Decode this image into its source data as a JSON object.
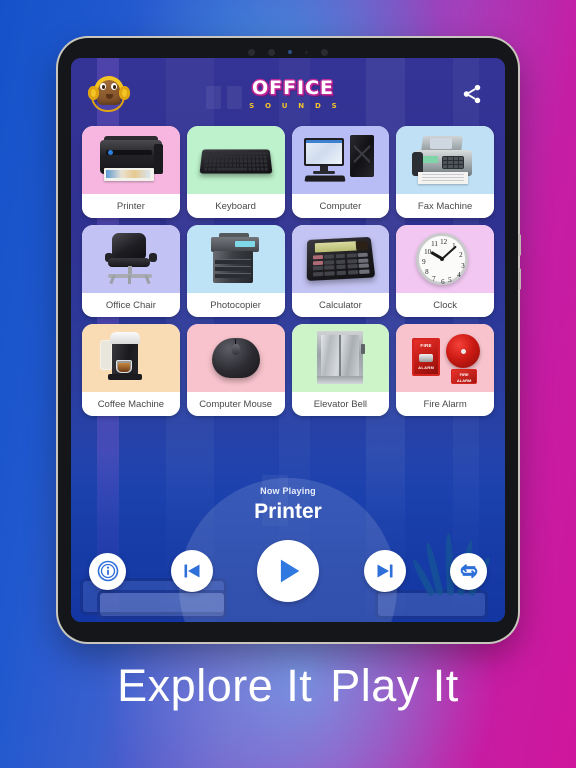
{
  "app": {
    "title_main": "OFFICE",
    "title_sub": "S O U N D S",
    "mascot_icon": "headphone-box-mascot-icon",
    "share_icon": "share-icon"
  },
  "grid": {
    "items": [
      {
        "label": "Printer",
        "art": "printer",
        "bg": "#f6b6e0"
      },
      {
        "label": "Keyboard",
        "art": "keyboard",
        "bg": "#bdf2cc"
      },
      {
        "label": "Computer",
        "art": "computer",
        "bg": "#b9bdf5"
      },
      {
        "label": "Fax Machine",
        "art": "fax",
        "bg": "#bfe0f5"
      },
      {
        "label": "Office Chair",
        "art": "chair",
        "bg": "#c3c2f4"
      },
      {
        "label": "Photocopier",
        "art": "photocopier",
        "bg": "#bfe3f6"
      },
      {
        "label": "Calculator",
        "art": "calculator",
        "bg": "#c3c4f3"
      },
      {
        "label": "Clock",
        "art": "clock",
        "bg": "#f2c8f2"
      },
      {
        "label": "Coffee Machine",
        "art": "coffee",
        "bg": "#fadcb4"
      },
      {
        "label": "Computer Mouse",
        "art": "mouse",
        "bg": "#f8c3cc"
      },
      {
        "label": "Elevator Bell",
        "art": "elevator",
        "bg": "#cdf3c8"
      },
      {
        "label": "Fire Alarm",
        "art": "firealarm",
        "bg": "#f8c3cc"
      }
    ]
  },
  "player": {
    "now_playing_label": "Now Playing",
    "track_title": "Printer",
    "controls": [
      {
        "name": "info-button",
        "icon": "info-icon"
      },
      {
        "name": "previous-button",
        "icon": "skip-previous-icon"
      },
      {
        "name": "play-button",
        "icon": "play-icon"
      },
      {
        "name": "next-button",
        "icon": "skip-next-icon"
      },
      {
        "name": "repeat-button",
        "icon": "repeat-icon"
      }
    ]
  },
  "tagline": {
    "part1": "Explore It",
    "part2": "Play It"
  },
  "clock_art": {
    "numbers": [
      "12",
      "1",
      "2",
      "3",
      "4",
      "5",
      "6",
      "7",
      "8",
      "9",
      "10",
      "11"
    ]
  },
  "fire_alarm_art": {
    "top_text": "FIRE",
    "bottom_text": "ALARM",
    "sign_line1": "FIRE",
    "sign_line2": "ALARM"
  },
  "colors": {
    "accent_blue": "#2f6fd8",
    "screen_bg": "#2d3490",
    "tile_bg": "#ffffff",
    "title_gold": "#f4c328",
    "title_outline": "#c0289c"
  }
}
